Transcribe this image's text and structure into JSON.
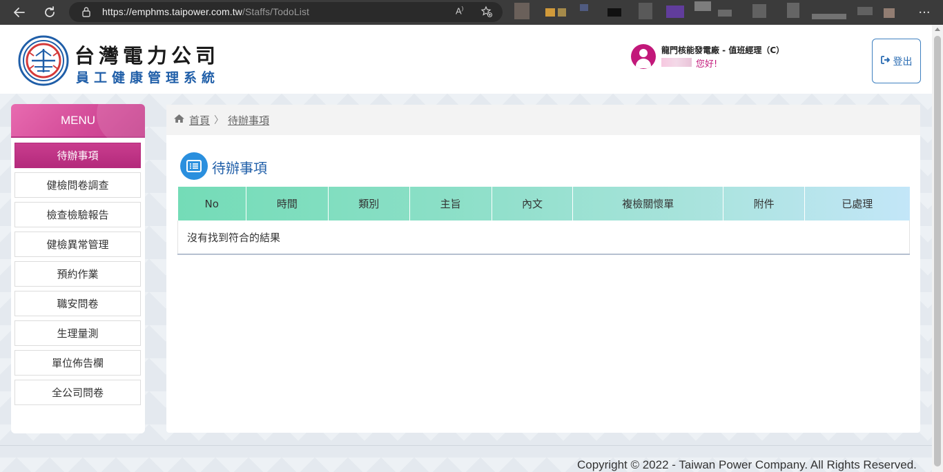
{
  "browser": {
    "url_host": "https://emphms.taipower.com.tw",
    "url_path": "/Staffs/TodoList",
    "read_aloud_label": "A",
    "more_label": "···"
  },
  "header": {
    "company_name": "台灣電力公司",
    "system_name": "員工健康管理系統",
    "user_dept": "龍門核能發電廠 - 值班經理（C）",
    "user_greeting": "您好!",
    "logout_label": "登出"
  },
  "sidebar": {
    "menu_title": "MENU",
    "items": [
      {
        "label": "待辦事項",
        "active": true
      },
      {
        "label": "健檢問卷調查"
      },
      {
        "label": "檢查檢驗報告"
      },
      {
        "label": "健檢異常管理"
      },
      {
        "label": "預約作業"
      },
      {
        "label": "職安問卷"
      },
      {
        "label": "生理量測"
      },
      {
        "label": "單位佈告欄"
      },
      {
        "label": "全公司問卷"
      }
    ]
  },
  "breadcrumb": {
    "home": "首頁",
    "separator": "〉",
    "current": "待辦事項"
  },
  "main": {
    "page_title": "待辦事項",
    "table": {
      "columns": [
        "No",
        "時間",
        "類別",
        "主旨",
        "內文",
        "複檢關懷單",
        "附件",
        "已處理"
      ],
      "empty_message": "沒有找到符合的結果"
    }
  },
  "footer": {
    "copyright": "Copyright © 2022 - Taiwan Power Company. All Rights Reserved."
  },
  "colors": {
    "brand_pink": "#c2187a",
    "brand_blue": "#1f5ea8",
    "table_header_start": "#74dcb7",
    "table_header_end": "#c3e6f8"
  }
}
